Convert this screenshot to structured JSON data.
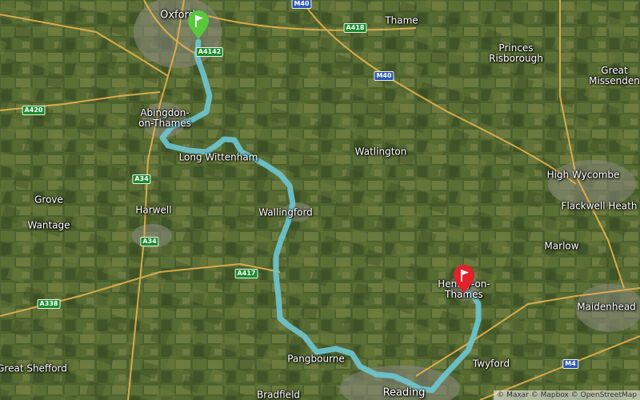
{
  "colors": {
    "route": "#6ec7d3",
    "road": "#e6b24e",
    "start_flag": "#58c83c",
    "end_flag": "#e0222a",
    "a_road_shield": "#1d8a2e",
    "motorway_shield": "#2f57b3"
  },
  "places": {
    "oxford": "Oxford",
    "thame": "Thame",
    "princes_risborough": "Princes\nRisborough",
    "great_missenden": "Great\nMissenden",
    "abingdon": "Abingdon-\non-Thames",
    "watlington": "Watlington",
    "long_wittenham": "Long Wittenham",
    "high_wycombe": "High Wycombe",
    "grove": "Grove",
    "wantage": "Wantage",
    "harwell": "Harwell",
    "wallingford": "Wallingford",
    "flackwell_heath": "Flackwell Heath",
    "marlow": "Marlow",
    "henley": "Henley-on-\nThames",
    "maidenhead": "Maidenhead",
    "pangbourne": "Pangbourne",
    "twyford": "Twyford",
    "great_shefford": "Great Shefford",
    "reading": "Reading",
    "bradfield": "Bradfield"
  },
  "roads": {
    "m40_north": "M40",
    "a418": "A418",
    "a4142": "A4142",
    "m40": "M40",
    "a420": "A420",
    "a34_north": "A34",
    "a34_south": "A34",
    "a417": "A417",
    "a338": "A338",
    "m4": "M4"
  },
  "markers": {
    "start": "start-flag",
    "end": "end-flag"
  },
  "attribution": "© Maxar © Mapbox © OpenStreetMap"
}
